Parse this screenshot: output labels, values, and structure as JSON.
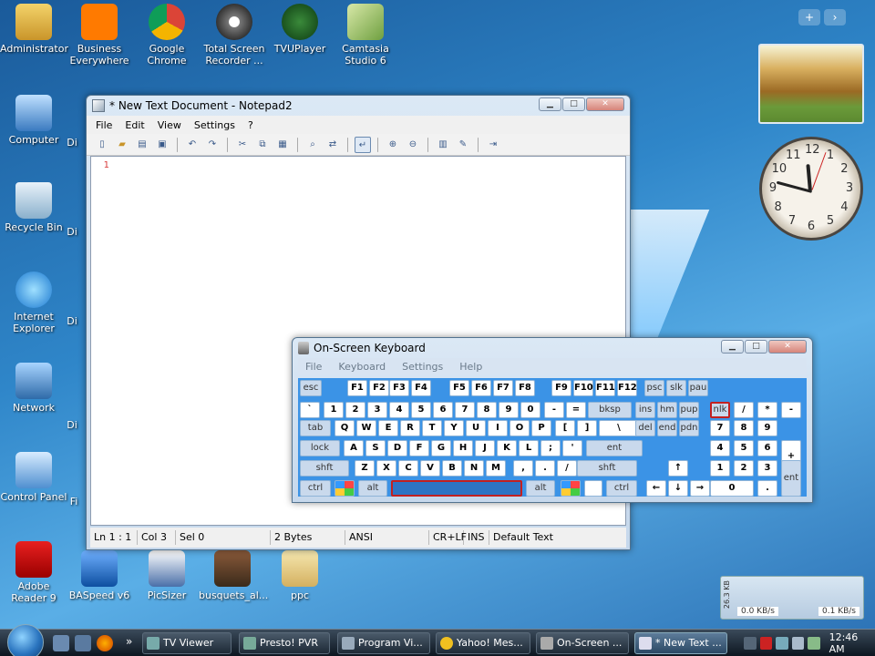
{
  "desktop": {
    "icons": [
      {
        "label": "Administrator"
      },
      {
        "label": "Business Everywhere"
      },
      {
        "label": "Google Chrome"
      },
      {
        "label": "Total Screen Recorder ..."
      },
      {
        "label": "TVUPlayer"
      },
      {
        "label": "Camtasia Studio 6"
      },
      {
        "label": "Computer"
      },
      {
        "label": "Recycle Bin"
      },
      {
        "label": "Internet Explorer"
      },
      {
        "label": "Network"
      },
      {
        "label": "Control Panel"
      },
      {
        "label": "Adobe Reader 9"
      },
      {
        "label": "BASpeed v6"
      },
      {
        "label": "PicSizer"
      },
      {
        "label": "busquets_al..."
      },
      {
        "label": "ppc"
      }
    ],
    "partial_labels": [
      "Di",
      "Di",
      "Di",
      "Di",
      "Fi"
    ]
  },
  "notepad": {
    "title": "* New Text Document - Notepad2",
    "menu": [
      "File",
      "Edit",
      "View",
      "Settings",
      "?"
    ],
    "line_number": "1",
    "status": {
      "position": "Ln 1 : 1",
      "col": "Col 3",
      "sel": "Sel 0",
      "size": "2 Bytes",
      "encoding": "ANSI",
      "eol": "CR+LF",
      "mode": "INS",
      "scheme": "Default Text"
    }
  },
  "osk": {
    "title": "On-Screen Keyboard",
    "menu": [
      "File",
      "Keyboard",
      "Settings",
      "Help"
    ],
    "rows": {
      "fn": [
        "esc",
        "F1",
        "F2",
        "F3",
        "F4",
        "F5",
        "F6",
        "F7",
        "F8",
        "F9",
        "F10",
        "F11",
        "F12",
        "psc",
        "slk",
        "pau"
      ],
      "num": [
        "`",
        "1",
        "2",
        "3",
        "4",
        "5",
        "6",
        "7",
        "8",
        "9",
        "0",
        "-",
        "=",
        "bksp",
        "ins",
        "hm",
        "pup",
        "nlk",
        "/",
        "*",
        "-"
      ],
      "top": [
        "tab",
        "Q",
        "W",
        "E",
        "R",
        "T",
        "Y",
        "U",
        "I",
        "O",
        "P",
        "[",
        "]",
        "\\",
        "del",
        "end",
        "pdn",
        "7",
        "8",
        "9"
      ],
      "home": [
        "lock",
        "A",
        "S",
        "D",
        "F",
        "G",
        "H",
        "J",
        "K",
        "L",
        ";",
        "'",
        "ent",
        "4",
        "5",
        "6",
        "+"
      ],
      "bottom": [
        "shft",
        "Z",
        "X",
        "C",
        "V",
        "B",
        "N",
        "M",
        ",",
        ".",
        "/",
        "shft",
        "↑",
        "1",
        "2",
        "3"
      ],
      "space": [
        "ctrl",
        "alt",
        "alt",
        "ctrl",
        "←",
        "↓",
        "→",
        "0",
        ".",
        "ent"
      ]
    }
  },
  "gadgets": {
    "top_buttons": [
      "+",
      "›"
    ],
    "clock_numbers": [
      "12",
      "1",
      "2",
      "3",
      "4",
      "5",
      "6",
      "7",
      "8",
      "9",
      "10",
      "11"
    ],
    "network": {
      "label": "26.3 KB",
      "down": "0.0 KB/s",
      "up": "0.1 KB/s"
    }
  },
  "taskbar": {
    "buttons": [
      {
        "label": "TV Viewer"
      },
      {
        "label": "Presto! PVR"
      },
      {
        "label": "Program Vi..."
      },
      {
        "label": "Yahoo! Mes..."
      },
      {
        "label": "On-Screen ..."
      },
      {
        "label": "* New Text ..."
      }
    ],
    "overflow": "»",
    "time": "12:46 AM"
  }
}
